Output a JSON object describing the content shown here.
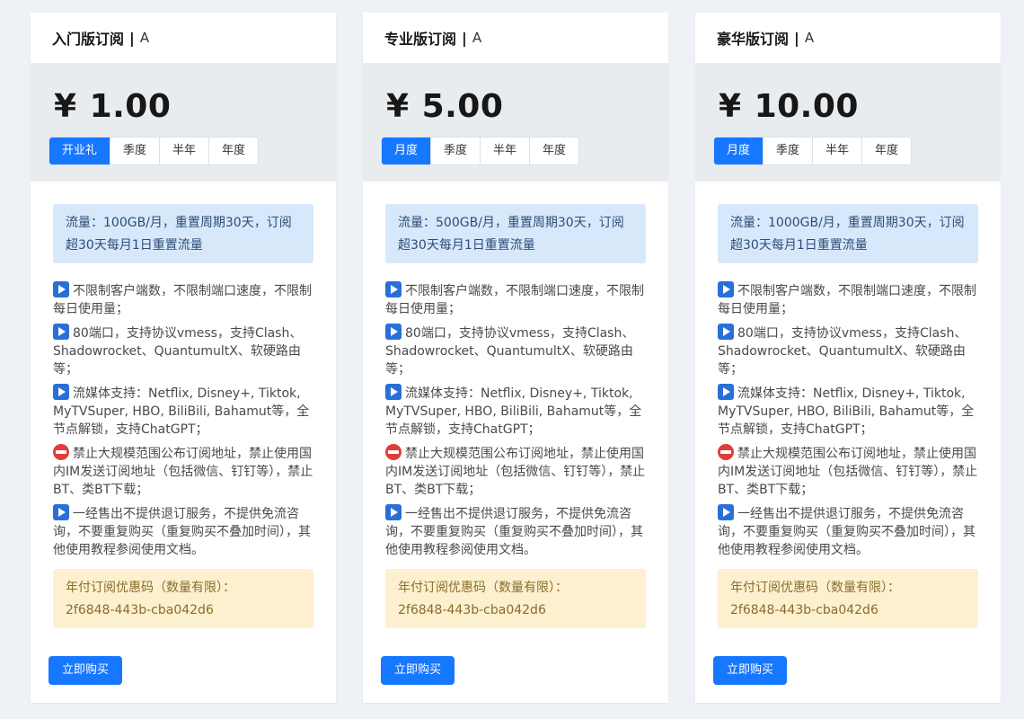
{
  "colors": {
    "accent": "#1677ff",
    "traffic_bg": "#d8e8fb",
    "coupon_bg": "#fdf0cf",
    "stop_icon": "#e23b3b",
    "play_icon": "#2a6fd8"
  },
  "plans": [
    {
      "name": "入门版订阅",
      "separator": "|",
      "tag": "A",
      "currency": "¥",
      "price": "1.00",
      "periods": [
        "开业礼",
        "季度",
        "半年",
        "年度"
      ],
      "active_period": "开业礼",
      "traffic": "流量：100GB/月，重置周期30天，订阅超30天每月1日重置流量",
      "features": [
        {
          "icon": "play-icon",
          "text": "不限制客户端数，不限制端口速度，不限制每日使用量；"
        },
        {
          "icon": "play-icon",
          "text": "80端口，支持协议vmess，支持Clash、Shadowrocket、QuantumultX、软硬路由等；"
        },
        {
          "icon": "play-icon",
          "text": "流媒体支持：Netflix, Disney+, Tiktok, MyTVSuper, HBO, BiliBili, Bahamut等，全节点解锁，支持ChatGPT；"
        },
        {
          "icon": "no-entry-icon",
          "text": "禁止大规模范围公布订阅地址，禁止使用国内IM发送订阅地址（包括微信、钉钉等），禁止BT、类BT下载；"
        },
        {
          "icon": "play-icon",
          "text": "一经售出不提供退订服务，不提供免流咨询，不要重复购买（重复购买不叠加时间），其他使用教程参阅使用文档。"
        }
      ],
      "coupon_title": "年付订阅优惠码（数量有限）：",
      "coupon_code": "2f6848-443b-cba042d6",
      "buy_label": "立即购买"
    },
    {
      "name": "专业版订阅",
      "separator": "|",
      "tag": "A",
      "currency": "¥",
      "price": "5.00",
      "periods": [
        "月度",
        "季度",
        "半年",
        "年度"
      ],
      "active_period": "月度",
      "traffic": "流量：500GB/月，重置周期30天，订阅超30天每月1日重置流量",
      "features": [
        {
          "icon": "play-icon",
          "text": "不限制客户端数，不限制端口速度，不限制每日使用量；"
        },
        {
          "icon": "play-icon",
          "text": "80端口，支持协议vmess，支持Clash、Shadowrocket、QuantumultX、软硬路由等；"
        },
        {
          "icon": "play-icon",
          "text": "流媒体支持：Netflix, Disney+, Tiktok, MyTVSuper, HBO, BiliBili, Bahamut等，全节点解锁，支持ChatGPT；"
        },
        {
          "icon": "no-entry-icon",
          "text": "禁止大规模范围公布订阅地址，禁止使用国内IM发送订阅地址（包括微信、钉钉等），禁止BT、类BT下载；"
        },
        {
          "icon": "play-icon",
          "text": "一经售出不提供退订服务，不提供免流咨询，不要重复购买（重复购买不叠加时间），其他使用教程参阅使用文档。"
        }
      ],
      "coupon_title": "年付订阅优惠码（数量有限）：",
      "coupon_code": "2f6848-443b-cba042d6",
      "buy_label": "立即购买"
    },
    {
      "name": "豪华版订阅",
      "separator": "|",
      "tag": "A",
      "currency": "¥",
      "price": "10.00",
      "periods": [
        "月度",
        "季度",
        "半年",
        "年度"
      ],
      "active_period": "月度",
      "traffic": "流量：1000GB/月，重置周期30天，订阅超30天每月1日重置流量",
      "features": [
        {
          "icon": "play-icon",
          "text": "不限制客户端数，不限制端口速度，不限制每日使用量；"
        },
        {
          "icon": "play-icon",
          "text": "80端口，支持协议vmess，支持Clash、Shadowrocket、QuantumultX、软硬路由等；"
        },
        {
          "icon": "play-icon",
          "text": "流媒体支持：Netflix, Disney+, Tiktok, MyTVSuper, HBO, BiliBili, Bahamut等，全节点解锁，支持ChatGPT；"
        },
        {
          "icon": "no-entry-icon",
          "text": "禁止大规模范围公布订阅地址，禁止使用国内IM发送订阅地址（包括微信、钉钉等），禁止BT、类BT下载；"
        },
        {
          "icon": "play-icon",
          "text": "一经售出不提供退订服务，不提供免流咨询，不要重复购买（重复购买不叠加时间），其他使用教程参阅使用文档。"
        }
      ],
      "coupon_title": "年付订阅优惠码（数量有限）：",
      "coupon_code": "2f6848-443b-cba042d6",
      "buy_label": "立即购买"
    }
  ]
}
